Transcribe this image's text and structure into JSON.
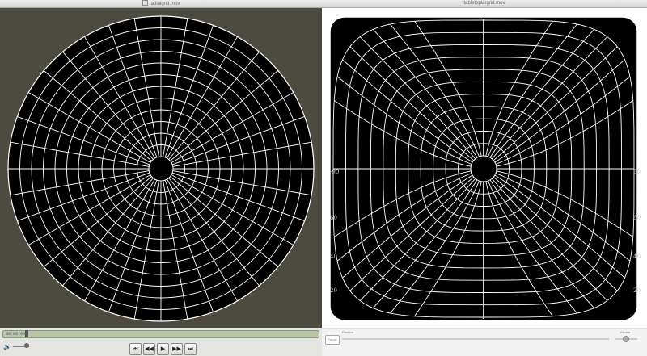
{
  "left_window": {
    "title": "radialgrid.mov",
    "timecode": "00:00:00",
    "progress": 0.07
  },
  "right_window": {
    "title": "tabletoplargrid.mov",
    "pause_label": "Pause",
    "position_label": "Position",
    "volume_label": "Volume",
    "angle_labels": [
      "-90",
      "60",
      "40",
      "20",
      "90",
      "60",
      "40",
      "20"
    ]
  },
  "transport": {
    "buttons": [
      "skip-back",
      "rewind",
      "play",
      "fast-forward",
      "skip-forward"
    ],
    "glyphs": [
      "⏮",
      "◀◀",
      "▶",
      "▶▶",
      "⏭"
    ]
  },
  "colors": {
    "background": "#4d4a3f",
    "grid": "#ffffff",
    "disc": "#000000"
  }
}
